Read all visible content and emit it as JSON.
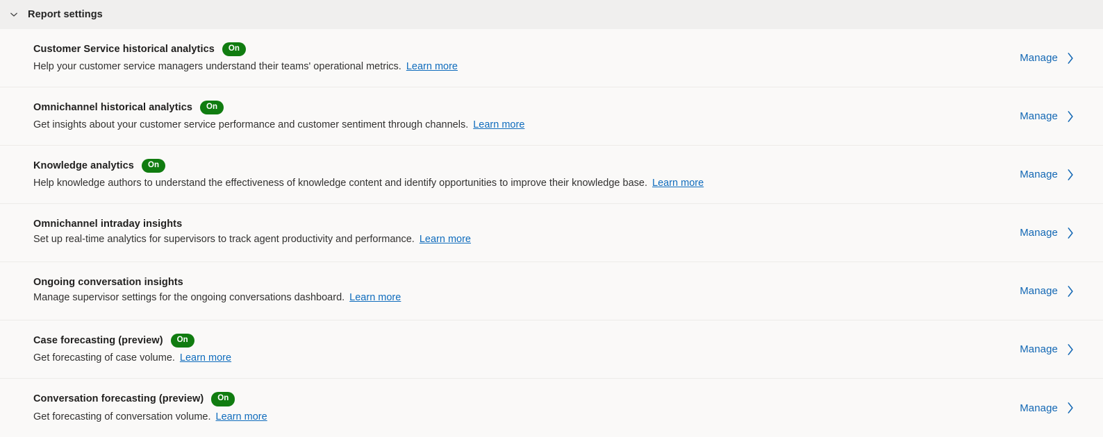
{
  "header": {
    "title": "Report settings",
    "expanded": true,
    "toggle_icon": "chevron-down-icon",
    "background": "#f0efee"
  },
  "colors": {
    "badge_on_bg": "#107c10",
    "badge_on_text": "#ffffff",
    "link": "#0f6cbd",
    "manage_link": "#1267b4",
    "title_text": "#201f1e",
    "body_text": "#323130",
    "row_divider": "#edebe9",
    "page_background": "#faf9f8"
  },
  "common": {
    "learn_more_label": "Learn more",
    "manage_label": "Manage",
    "manage_icon": "chevron-right-icon",
    "badge_on_label": "On"
  },
  "settings": [
    {
      "title": "Customer Service historical analytics",
      "status": "On",
      "has_status": true,
      "description": "Help your customer service managers understand their teams' operational metrics.",
      "link_label": "Learn more",
      "action_label": "Manage"
    },
    {
      "title": "Omnichannel historical analytics",
      "status": "On",
      "has_status": true,
      "description": "Get insights about your customer service performance and customer sentiment through channels.",
      "link_label": "Learn more",
      "action_label": "Manage"
    },
    {
      "title": "Knowledge analytics",
      "status": "On",
      "has_status": true,
      "description": "Help knowledge authors to understand the effectiveness of knowledge content and identify opportunities to improve their knowledge base.",
      "link_label": "Learn more",
      "action_label": "Manage"
    },
    {
      "title": "Omnichannel intraday insights",
      "status": null,
      "has_status": false,
      "description": "Set up real-time analytics for supervisors to track agent productivity and performance.",
      "link_label": "Learn more",
      "action_label": "Manage"
    },
    {
      "title": "Ongoing conversation insights",
      "status": null,
      "has_status": false,
      "description": "Manage supervisor settings for the ongoing conversations dashboard.",
      "link_label": "Learn more",
      "action_label": "Manage"
    },
    {
      "title": "Case forecasting (preview)",
      "status": "On",
      "has_status": true,
      "description": "Get forecasting of case volume.",
      "link_label": "Learn more",
      "action_label": "Manage"
    },
    {
      "title": "Conversation forecasting (preview)",
      "status": "On",
      "has_status": true,
      "description": "Get forecasting of conversation volume.",
      "link_label": "Learn more",
      "action_label": "Manage"
    }
  ]
}
